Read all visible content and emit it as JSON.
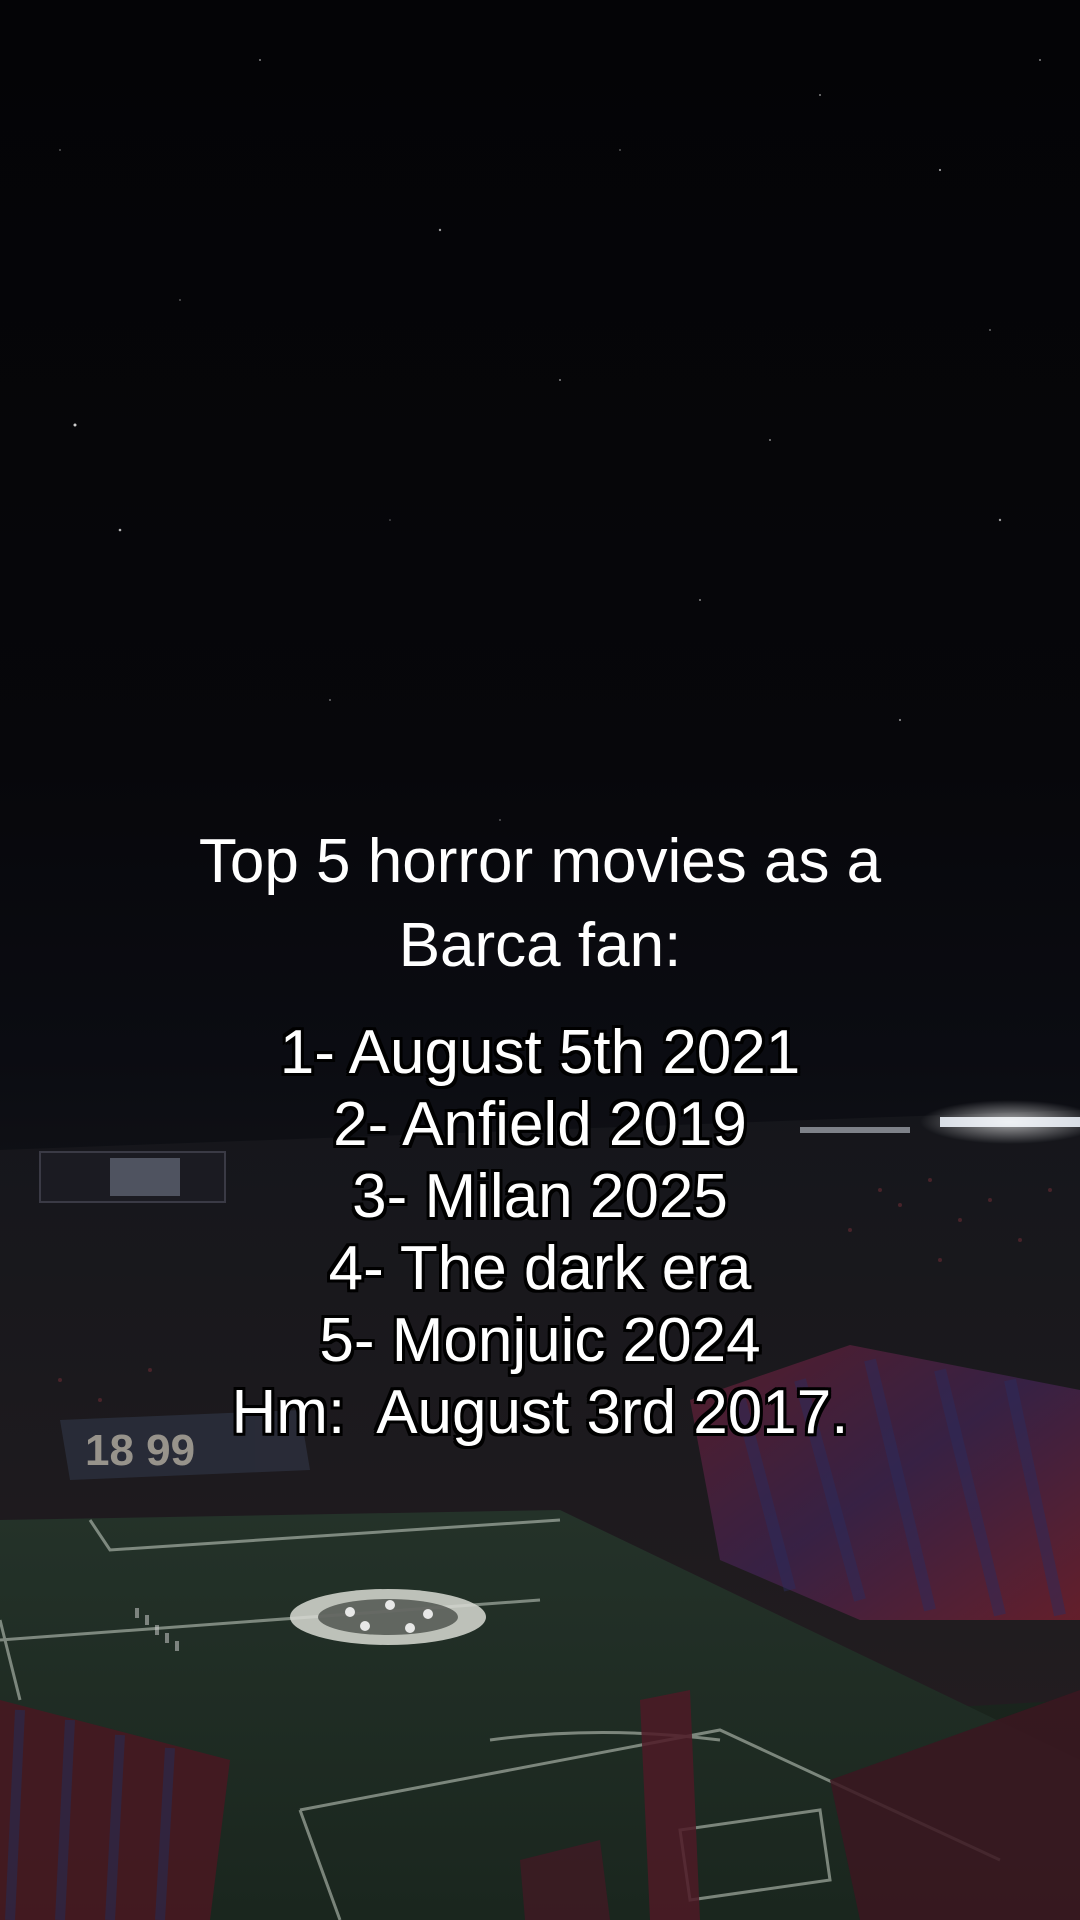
{
  "caption": {
    "title_line1": "Top 5 horror movies as a",
    "title_line2": "Barca fan:",
    "items": [
      "1- August 5th 2021",
      "2- Anfield 2019",
      "3- Milan 2025",
      "4- The dark era",
      "5- Monjuic 2024",
      "Hm:  August 3rd 2017."
    ]
  },
  "background": {
    "scene": "night-stadium",
    "colors": {
      "sky": "#050507",
      "pitch": "#1f2d24",
      "crowd_red": "#7a1f2c",
      "crowd_blue": "#1d2a55",
      "lights": "#e8eef8"
    }
  }
}
